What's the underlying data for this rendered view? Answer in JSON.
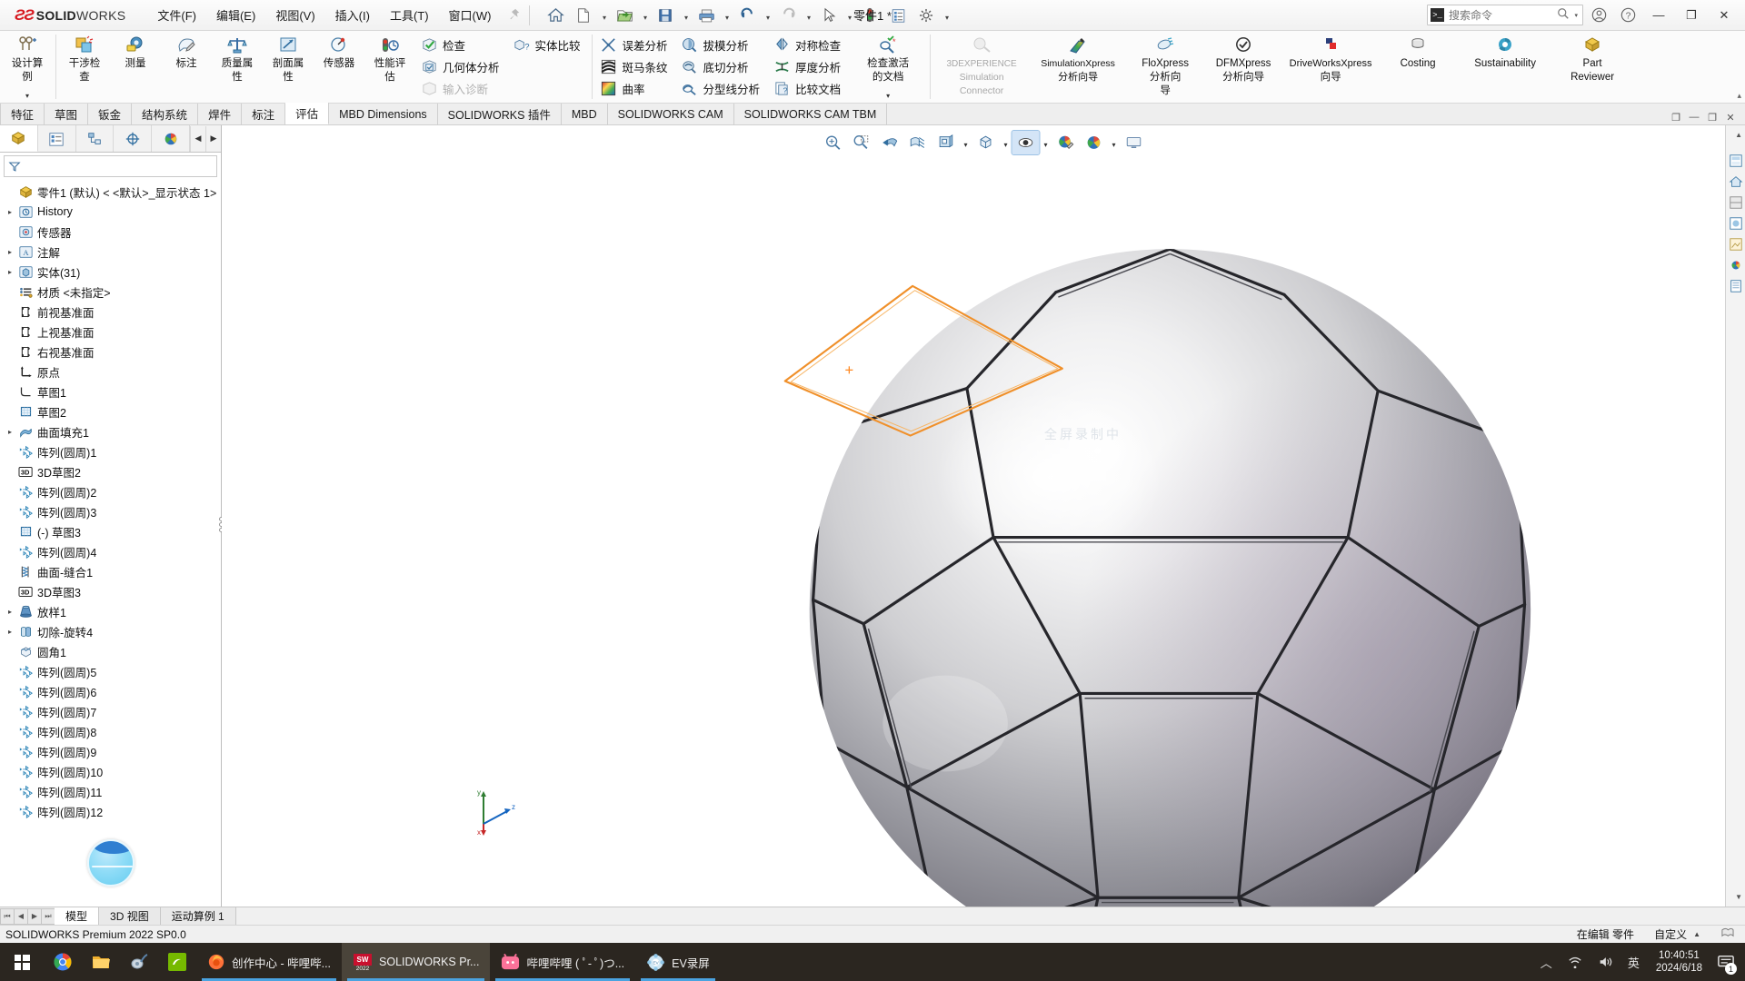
{
  "app": {
    "brand_ds": "2S",
    "brand_name_bold": "SOLID",
    "brand_name_light": "WORKS",
    "document_title": "零件1 *"
  },
  "menubar": {
    "items": [
      {
        "label": "文件(F)",
        "name": "menu-file"
      },
      {
        "label": "编辑(E)",
        "name": "menu-edit"
      },
      {
        "label": "视图(V)",
        "name": "menu-view"
      },
      {
        "label": "插入(I)",
        "name": "menu-insert"
      },
      {
        "label": "工具(T)",
        "name": "menu-tools"
      },
      {
        "label": "窗口(W)",
        "name": "menu-window"
      }
    ],
    "pin": "📌"
  },
  "quick_access": {
    "buttons": [
      {
        "name": "home-icon",
        "glyph": "⌂"
      },
      {
        "name": "new-document-icon",
        "glyph": "🗋"
      },
      {
        "name": "open-document-icon",
        "glyph": "📂"
      },
      {
        "name": "save-icon",
        "glyph": "💾"
      },
      {
        "name": "print-icon",
        "glyph": "🖨"
      },
      {
        "name": "undo-icon",
        "glyph": "↺"
      },
      {
        "name": "redo-icon",
        "glyph": "↻"
      },
      {
        "name": "select-cursor-icon",
        "glyph": "➤"
      },
      {
        "name": "rebuild-traffic-light-icon",
        "glyph": "🚦"
      },
      {
        "name": "options-list-icon",
        "glyph": "▤"
      },
      {
        "name": "settings-gear-icon",
        "glyph": "⚙"
      }
    ]
  },
  "search": {
    "placeholder": "搜索命令",
    "prompt_glyph": ">_"
  },
  "title_right": {
    "account_icon": "account-icon",
    "help_icon": "help-icon",
    "minimize": "—",
    "restore": "❐",
    "close": "✕"
  },
  "ribbon": {
    "design_study": {
      "label1": "设计算",
      "label2": "例",
      "caret": "▾"
    },
    "group1": [
      {
        "l1": "干涉检",
        "l2": "查",
        "name": "interference-check"
      },
      {
        "l1": "测量",
        "l2": "",
        "name": "measure"
      },
      {
        "l1": "标注",
        "l2": "",
        "name": "markup"
      },
      {
        "l1": "质量属",
        "l2": "性",
        "name": "mass-properties"
      },
      {
        "l1": "剖面属",
        "l2": "性",
        "name": "section-properties"
      },
      {
        "l1": "传感器",
        "l2": "",
        "name": "sensor"
      },
      {
        "l1": "性能评",
        "l2": "估",
        "name": "performance-evaluation"
      }
    ],
    "group2_col1": [
      {
        "label": "检查",
        "name": "check",
        "dim": false
      },
      {
        "label": "几何体分析",
        "name": "geometry-analysis",
        "dim": false
      },
      {
        "label": "输入诊断",
        "name": "import-diagnostics",
        "dim": true
      }
    ],
    "group2_col2": [
      {
        "label": "实体比较",
        "name": "compare-bodies",
        "dim": false
      }
    ],
    "group3_col1": [
      {
        "label": "误差分析",
        "name": "deviation-analysis"
      },
      {
        "label": "斑马条纹",
        "name": "zebra-stripes"
      },
      {
        "label": "曲率",
        "name": "curvature"
      }
    ],
    "group3_col2": [
      {
        "label": "拔模分析",
        "name": "draft-analysis"
      },
      {
        "label": "底切分析",
        "name": "undercut-analysis"
      },
      {
        "label": "分型线分析",
        "name": "parting-line-analysis"
      }
    ],
    "group3_col3": [
      {
        "label": "对称检查",
        "name": "symmetry-check"
      },
      {
        "label": "厚度分析",
        "name": "thickness-analysis"
      },
      {
        "label": "比较文档",
        "name": "compare-documents"
      }
    ],
    "check_active_doc": {
      "l1": "检查激活",
      "l2": "的文档",
      "caret": "▾",
      "name": "check-active-document"
    },
    "group4": [
      {
        "l1": "3DEXPERIENCE",
        "l2": "Simulation",
        "l3": "Connector",
        "dim": true,
        "name": "3dexperience-simulation-connector"
      },
      {
        "l1": "SimulationXpress",
        "l2": "分析向导",
        "l3": "",
        "dim": false,
        "name": "simulationxpress-wizard"
      },
      {
        "l1": "FloXpress",
        "l2": "分析向",
        "l3": "导",
        "dim": false,
        "name": "floxpress-wizard"
      },
      {
        "l1": "DFMXpress",
        "l2": "分析向导",
        "l3": "",
        "dim": false,
        "name": "dfmxpress-wizard"
      },
      {
        "l1": "DriveWorksXpress",
        "l2": "向导",
        "l3": "",
        "dim": false,
        "name": "driveworksxpress-wizard"
      },
      {
        "l1": "Costing",
        "l2": "",
        "l3": "",
        "dim": false,
        "name": "costing"
      },
      {
        "l1": "Sustainability",
        "l2": "",
        "l3": "",
        "dim": false,
        "name": "sustainability"
      },
      {
        "l1": "Part",
        "l2": "Reviewer",
        "l3": "",
        "dim": false,
        "name": "part-reviewer"
      }
    ],
    "collapse_caret": "▴"
  },
  "command_tabs": {
    "items": [
      {
        "label": "特征",
        "active": false
      },
      {
        "label": "草图",
        "active": false
      },
      {
        "label": "钣金",
        "active": false
      },
      {
        "label": "结构系统",
        "active": false
      },
      {
        "label": "焊件",
        "active": false
      },
      {
        "label": "标注",
        "active": false
      },
      {
        "label": "评估",
        "active": true
      },
      {
        "label": "MBD Dimensions",
        "active": false
      },
      {
        "label": "SOLIDWORKS 插件",
        "active": false
      },
      {
        "label": "MBD",
        "active": false
      },
      {
        "label": "SOLIDWORKS CAM",
        "active": false
      },
      {
        "label": "SOLIDWORKS CAM TBM",
        "active": false
      }
    ]
  },
  "feature_manager": {
    "tabs": [
      {
        "name": "feature-tree-tab",
        "glyph": "🟡",
        "active": true
      },
      {
        "name": "property-manager-tab",
        "glyph": "▤",
        "active": false
      },
      {
        "name": "configuration-manager-tab",
        "glyph": "⌸",
        "active": false
      },
      {
        "name": "dimxpert-manager-tab",
        "glyph": "⊕",
        "active": false
      },
      {
        "name": "display-manager-tab",
        "glyph": "◕",
        "active": false
      }
    ],
    "nav_left": "◀",
    "nav_right": "▶",
    "filter_placeholder": "",
    "root": "零件1 (默认) < <默认>_显示状态 1>",
    "tree": [
      {
        "label": "History",
        "icon": "history-icon",
        "expandable": true,
        "indent": 1
      },
      {
        "label": "传感器",
        "icon": "sensors-icon",
        "expandable": false,
        "indent": 1
      },
      {
        "label": "注解",
        "icon": "annotations-icon",
        "expandable": true,
        "indent": 1
      },
      {
        "label": "实体(31)",
        "icon": "solid-bodies-icon",
        "expandable": true,
        "indent": 1
      },
      {
        "label": "材质 <未指定>",
        "icon": "material-icon",
        "expandable": false,
        "indent": 1
      },
      {
        "label": "前视基准面",
        "icon": "plane-icon",
        "expandable": false,
        "indent": 1
      },
      {
        "label": "上视基准面",
        "icon": "plane-icon",
        "expandable": false,
        "indent": 1
      },
      {
        "label": "右视基准面",
        "icon": "plane-icon",
        "expandable": false,
        "indent": 1
      },
      {
        "label": "原点",
        "icon": "origin-icon",
        "expandable": false,
        "indent": 1
      },
      {
        "label": "草图1",
        "icon": "sketch-icon",
        "expandable": false,
        "indent": 1
      },
      {
        "label": "草图2",
        "icon": "sketch-grid-icon",
        "expandable": false,
        "indent": 1
      },
      {
        "label": "曲面填充1",
        "icon": "fill-surface-icon",
        "expandable": true,
        "indent": 1
      },
      {
        "label": "阵列(圆周)1",
        "icon": "circular-pattern-icon",
        "expandable": false,
        "indent": 1
      },
      {
        "label": "3D草图2",
        "icon": "sketch-3d-icon",
        "expandable": false,
        "indent": 1
      },
      {
        "label": "阵列(圆周)2",
        "icon": "circular-pattern-icon",
        "expandable": false,
        "indent": 1
      },
      {
        "label": "阵列(圆周)3",
        "icon": "circular-pattern-icon",
        "expandable": false,
        "indent": 1
      },
      {
        "label": "(-) 草图3",
        "icon": "sketch-grid-icon",
        "expandable": false,
        "indent": 1
      },
      {
        "label": "阵列(圆周)4",
        "icon": "circular-pattern-icon",
        "expandable": false,
        "indent": 1
      },
      {
        "label": "曲面-缝合1",
        "icon": "knit-surface-icon",
        "expandable": false,
        "indent": 1
      },
      {
        "label": "3D草图3",
        "icon": "sketch-3d-icon",
        "expandable": false,
        "indent": 1
      },
      {
        "label": "放样1",
        "icon": "loft-icon",
        "expandable": true,
        "indent": 1
      },
      {
        "label": "切除-旋转4",
        "icon": "revolve-cut-icon",
        "expandable": true,
        "indent": 1
      },
      {
        "label": "圆角1",
        "icon": "fillet-icon",
        "expandable": false,
        "indent": 1
      },
      {
        "label": "阵列(圆周)5",
        "icon": "circular-pattern-icon",
        "expandable": false,
        "indent": 1
      },
      {
        "label": "阵列(圆周)6",
        "icon": "circular-pattern-icon",
        "expandable": false,
        "indent": 1
      },
      {
        "label": "阵列(圆周)7",
        "icon": "circular-pattern-icon",
        "expandable": false,
        "indent": 1
      },
      {
        "label": "阵列(圆周)8",
        "icon": "circular-pattern-icon",
        "expandable": false,
        "indent": 1
      },
      {
        "label": "阵列(圆周)9",
        "icon": "circular-pattern-icon",
        "expandable": false,
        "indent": 1
      },
      {
        "label": "阵列(圆周)10",
        "icon": "circular-pattern-icon",
        "expandable": false,
        "indent": 1
      },
      {
        "label": "阵列(圆周)11",
        "icon": "circular-pattern-icon",
        "expandable": false,
        "indent": 1
      },
      {
        "label": "阵列(圆周)12",
        "icon": "circular-pattern-icon",
        "expandable": false,
        "indent": 1
      }
    ]
  },
  "view_toolbar": {
    "buttons": [
      {
        "name": "zoom-to-fit-icon",
        "glyph": "🔍"
      },
      {
        "name": "zoom-to-area-icon",
        "glyph": "🔎"
      },
      {
        "name": "previous-view-icon",
        "glyph": "◁"
      },
      {
        "name": "section-view-icon",
        "glyph": "▨"
      },
      {
        "name": "view-orientation-icon",
        "glyph": "▣"
      },
      {
        "name": "display-style-icon",
        "glyph": "◻"
      },
      {
        "name": "hide-show-items-icon",
        "glyph": "👁",
        "pressed": true
      },
      {
        "name": "edit-appearance-icon",
        "glyph": "◕"
      },
      {
        "name": "apply-scene-icon",
        "glyph": "◑"
      },
      {
        "name": "view-settings-icon",
        "glyph": "🖵"
      }
    ]
  },
  "graphics": {
    "watermark": "全屏录制中",
    "triad": {
      "x": "x",
      "y": "y",
      "z": "z"
    }
  },
  "right_strip": {
    "icons": [
      {
        "name": "view-palette-icon",
        "glyph": "▤"
      },
      {
        "name": "home-appearance-icon",
        "glyph": "⌂"
      },
      {
        "name": "appearances-icon",
        "glyph": "◧"
      },
      {
        "name": "scenes-icon",
        "glyph": "▧"
      },
      {
        "name": "decals-icon",
        "glyph": "▨"
      },
      {
        "name": "lights-icon",
        "glyph": "◔"
      },
      {
        "name": "custom-properties-icon",
        "glyph": "▥"
      }
    ],
    "scroll_up": "▲",
    "scroll_down": "▼"
  },
  "bottom_tabs": {
    "nav": [
      "⏮",
      "◀",
      "▶",
      "⏭"
    ],
    "items": [
      {
        "label": "模型",
        "active": true
      },
      {
        "label": "3D 视图",
        "active": false
      },
      {
        "label": "运动算例 1",
        "active": false
      }
    ]
  },
  "statusbar": {
    "left": "SOLIDWORKS Premium 2022 SP0.0",
    "editing": "在编辑 零件",
    "custom": "自定义",
    "arrow": "▲",
    "overlay_icon": "sheet-icon"
  },
  "taskbar": {
    "start_name": "start-button",
    "pinned": [
      {
        "name": "chrome-icon",
        "glyph": "◉",
        "color": "#4285f4"
      },
      {
        "name": "file-explorer-icon",
        "glyph": "🗀",
        "color": "#ffc33c"
      },
      {
        "name": "media-player-icon",
        "glyph": "◎",
        "color": "#cccccc"
      },
      {
        "name": "nvidia-icon",
        "glyph": "▣",
        "color": "#76b900"
      }
    ],
    "tasks": [
      {
        "label": "创作中心 - 哔哩哔...",
        "icon": "firefox-icon",
        "active": false
      },
      {
        "label": "SOLIDWORKS Pr...",
        "icon": "solidworks-icon",
        "active": true
      },
      {
        "label": "哔哩哔哩 ( ﾟ- ﾟ)つ...",
        "icon": "bilibili-icon",
        "active": false
      },
      {
        "label": "EV录屏",
        "icon": "ev-recorder-icon",
        "active": false
      }
    ],
    "tray": [
      {
        "name": "show-hidden-icons",
        "glyph": "︿"
      },
      {
        "name": "network-icon",
        "glyph": "⌁"
      },
      {
        "name": "volume-icon",
        "glyph": "🔊"
      },
      {
        "name": "ime-icon",
        "glyph": "英"
      }
    ],
    "clock": {
      "time": "10:40:51",
      "date": "2024/6/18"
    },
    "notification": {
      "name": "notification-icon",
      "count": "1"
    }
  }
}
